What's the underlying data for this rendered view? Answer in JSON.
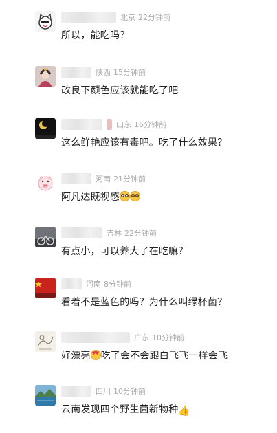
{
  "comments": [
    {
      "location": "北京",
      "time": "22分钟前",
      "text": "所以，能吃吗？",
      "avatar_icon": "cat-cartoon-avatar",
      "text_emoji": []
    },
    {
      "location": "陕西",
      "time": "15分钟前",
      "text": "改良下颜色应该就能吃了吧",
      "avatar_icon": "costume-girl-avatar",
      "text_emoji": []
    },
    {
      "location": "山东",
      "time": "16分钟前",
      "text": "这么鲜艳应该有毒吧。吃了什么效果？",
      "avatar_icon": "moon-night-avatar",
      "text_emoji": []
    },
    {
      "location": "河南",
      "time": "21分钟前",
      "text": "阿凡达既视感",
      "avatar_icon": "pig-cartoon-avatar",
      "text_emoji": [
        "flushed-face-emoji",
        "flushed-face-emoji"
      ]
    },
    {
      "location": "吉林",
      "time": "22分钟前",
      "text": "有点小，可以养大了在吃嘛？",
      "avatar_icon": "bicycle-photo-avatar",
      "text_emoji": []
    },
    {
      "location": "河南",
      "time": "8分钟前",
      "text": "看着不是蓝色的吗？为什么叫绿杯菌？",
      "avatar_icon": "red-flag-avatar",
      "text_emoji": []
    },
    {
      "location": "广东",
      "time": "10分钟前",
      "text_before": "好漂亮",
      "text": "吃了会不会跟白飞飞一样会飞",
      "avatar_icon": "sketch-drawing-avatar",
      "text_emoji": [
        "heart-eyes-emoji"
      ]
    },
    {
      "location": "四川",
      "time": "10分钟前",
      "text": "云南发现四个野生菌新物种",
      "avatar_icon": "lake-landscape-avatar",
      "text_emoji": [
        "thumbs-up-emoji"
      ]
    }
  ],
  "colors": {
    "meta_text": "#aaaaaa",
    "comment_text": "#222222",
    "background": "#ffffff"
  }
}
